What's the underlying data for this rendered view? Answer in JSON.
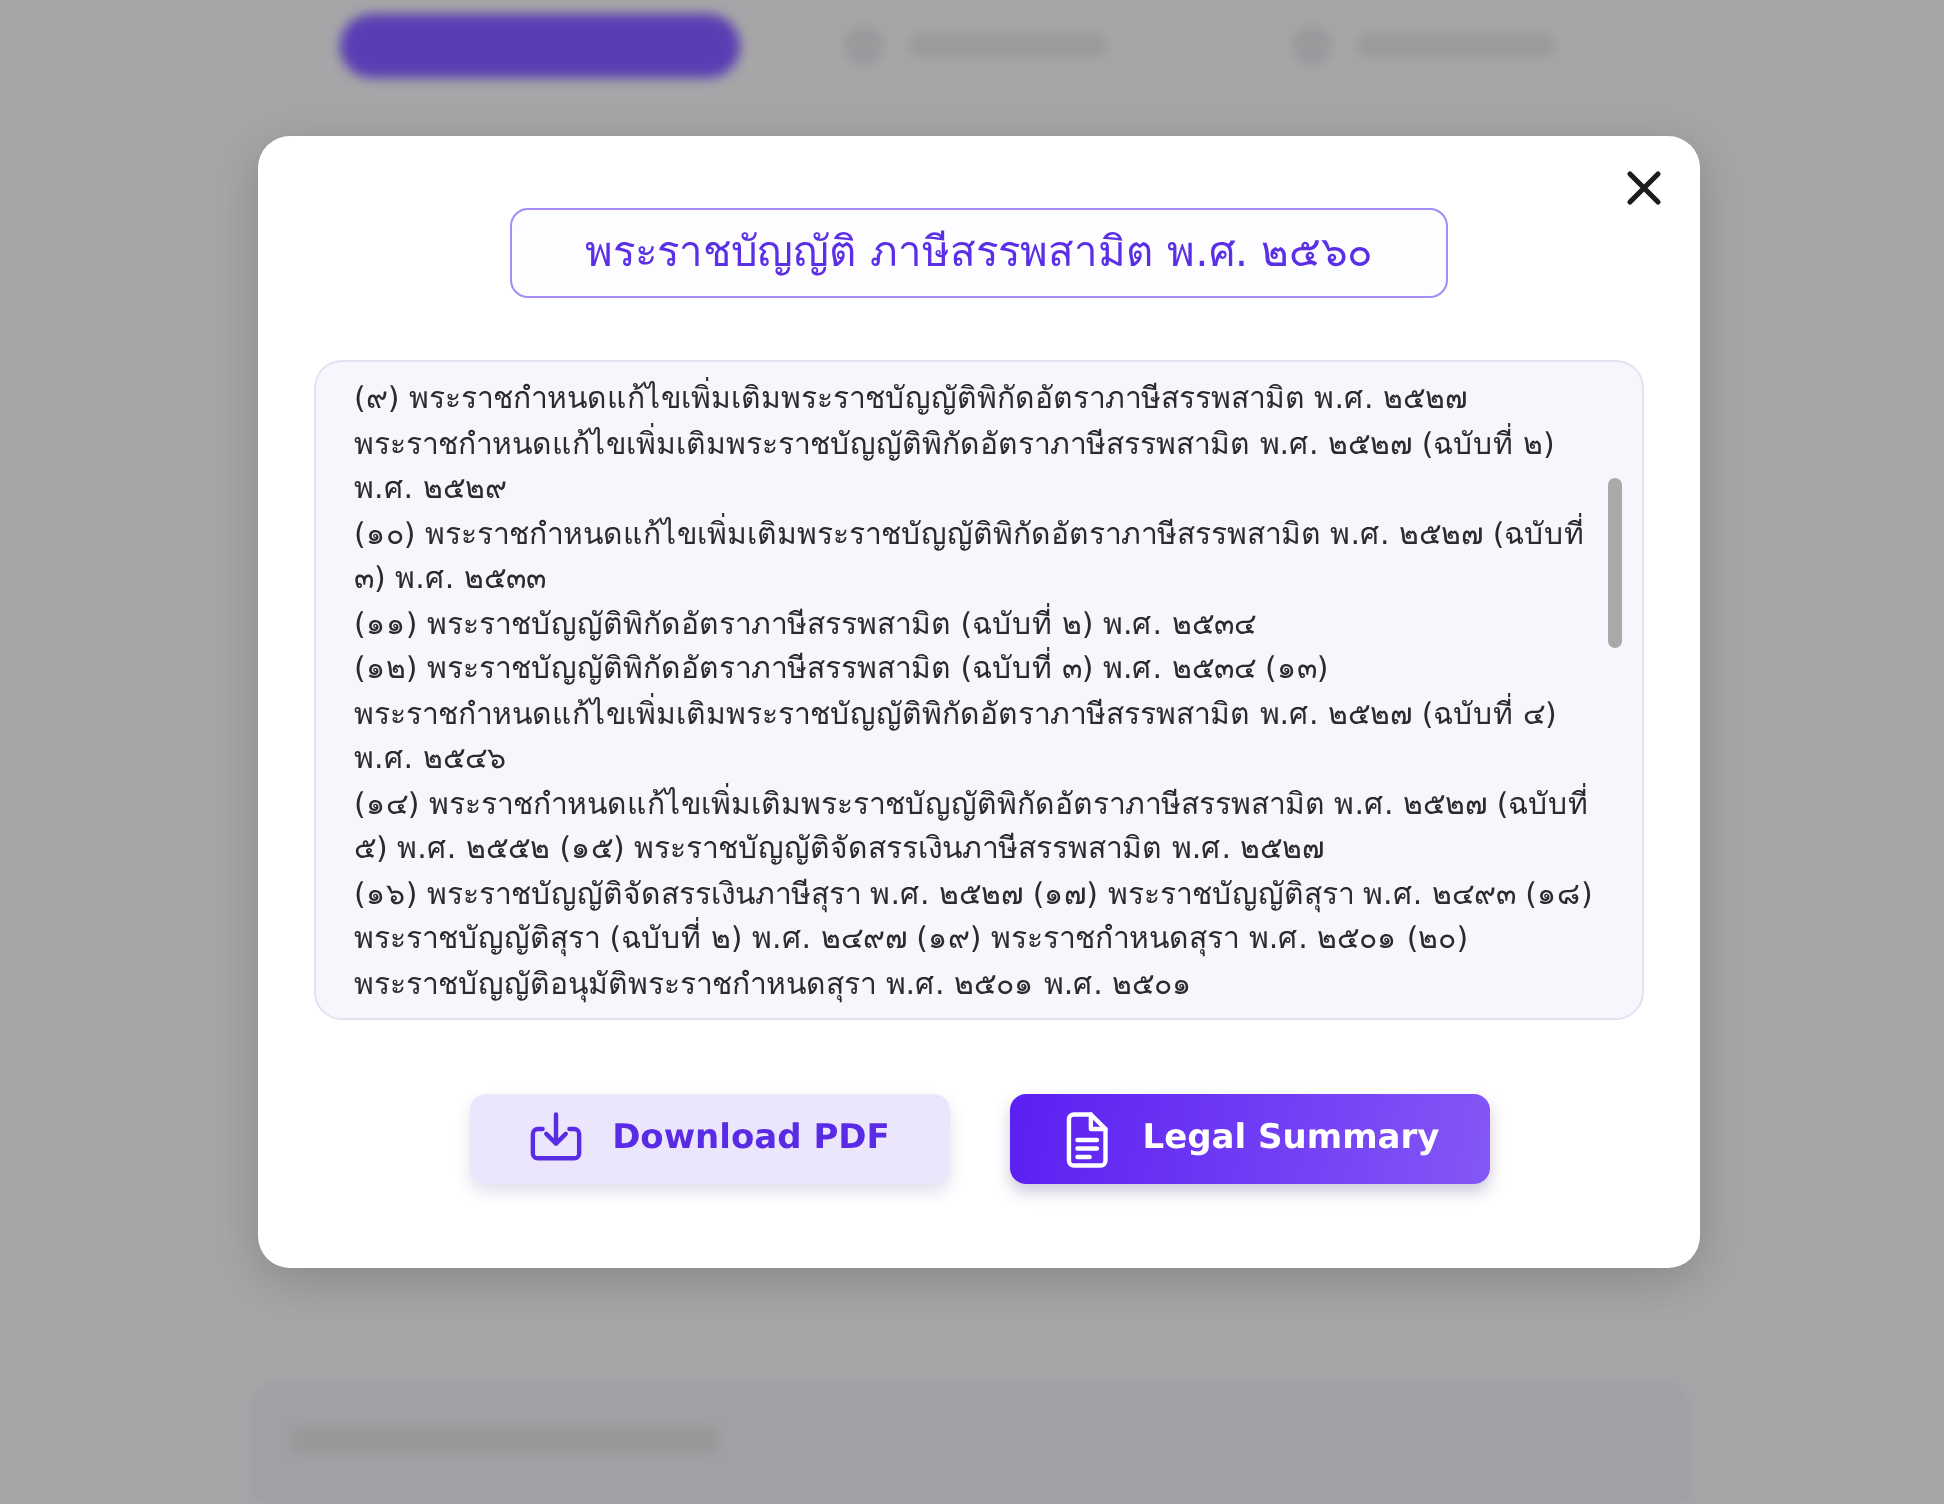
{
  "dialog": {
    "title": "พระราชบัญญัติ ภาษีสรรพสามิต พ.ศ. ๒๕๖๐",
    "text_lines": [
      "(๙) พระราชกำหนดแก้ไขเพิ่มเติมพระราชบัญญัติพิกัดอัตราภาษีสรรพสามิต พ.ศ. ๒๕๒๗",
      "พระราชกำหนดแก้ไขเพิ่มเติมพระราชบัญญัติพิกัดอัตราภาษีสรรพสามิต พ.ศ. ๒๕๒๗ (ฉบับที่ ๒)",
      "พ.ศ. ๒๕๒๙",
      "(๑๐) พระราชกำหนดแก้ไขเพิ่มเติมพระราชบัญญัติพิกัดอัตราภาษีสรรพสามิต พ.ศ. ๒๕๒๗ (ฉบับที่",
      "๓) พ.ศ. ๒๕๓๓",
      "(๑๑) พระราชบัญญัติพิกัดอัตราภาษีสรรพสามิต (ฉบับที่ ๒) พ.ศ. ๒๕๓๔",
      "(๑๒) พระราชบัญญัติพิกัดอัตราภาษีสรรพสามิต (ฉบับที่ ๓) พ.ศ. ๒๕๓๔ (๑๓)",
      "พระราชกำหนดแก้ไขเพิ่มเติมพระราชบัญญัติพิกัดอัตราภาษีสรรพสามิต พ.ศ. ๒๕๒๗ (ฉบับที่ ๔)",
      "พ.ศ. ๒๕๔๖",
      "(๑๔) พระราชกำหนดแก้ไขเพิ่มเติมพระราชบัญญัติพิกัดอัตราภาษีสรรพสามิต พ.ศ. ๒๕๒๗ (ฉบับที่",
      "๕) พ.ศ. ๒๕๕๒ (๑๕) พระราชบัญญัติจัดสรรเงินภาษีสรรพสามิต พ.ศ. ๒๕๒๗",
      "(๑๖) พระราชบัญญัติจัดสรรเงินภาษีสุรา พ.ศ. ๒๕๒๗ (๑๗) พระราชบัญญัติสุรา พ.ศ. ๒๔๙๓ (๑๘)",
      "พระราชบัญญัติสุรา (ฉบับที่ ๒) พ.ศ. ๒๔๙๗ (๑๙) พระราชกำหนดสุรา พ.ศ. ๒๕๐๑ (๒๐)",
      "พระราชบัญญัติอนุมัติพระราชกำหนดสุรา พ.ศ. ๒๕๐๑ พ.ศ. ๒๕๐๑"
    ],
    "buttons": [
      {
        "label": "Download PDF",
        "kind": "download"
      },
      {
        "label": "Legal Summary",
        "kind": "summary"
      }
    ]
  }
}
